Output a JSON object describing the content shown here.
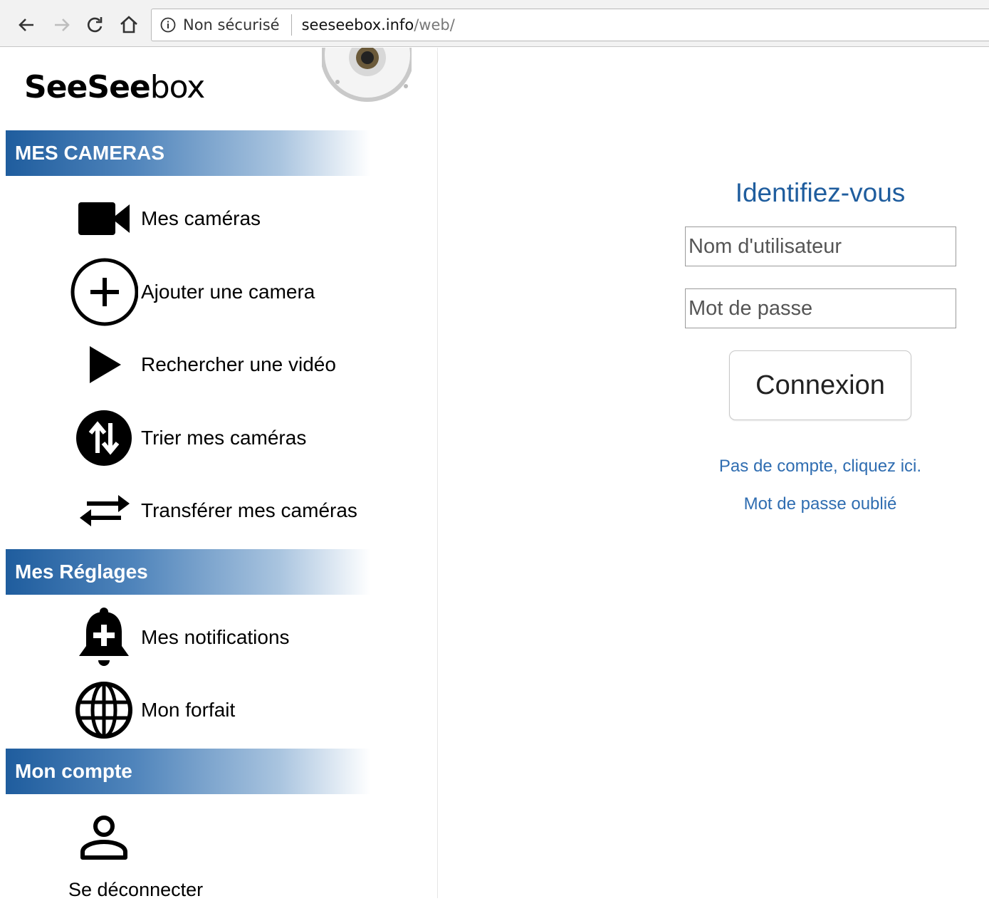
{
  "browser": {
    "security_label": "Non sécurisé",
    "url_host": "seeseebox.info",
    "url_path": "/web/"
  },
  "brand": {
    "logo_bold": "SeeSee",
    "logo_regular": "box"
  },
  "sidebar": {
    "sections": [
      {
        "title": "MES CAMERAS"
      },
      {
        "title": "Mes Réglages"
      },
      {
        "title": "Mon compte"
      }
    ],
    "cameras_items": [
      {
        "label": "Mes caméras",
        "icon": "video-camera-icon"
      },
      {
        "label": "Ajouter une camera",
        "icon": "add-circle-icon"
      },
      {
        "label": "Rechercher une vidéo",
        "icon": "play-icon"
      },
      {
        "label": "Trier mes caméras",
        "icon": "sort-icon"
      },
      {
        "label": "Transférer mes caméras",
        "icon": "transfer-icon"
      }
    ],
    "settings_items": [
      {
        "label": "Mes notifications",
        "icon": "bell-plus-icon"
      },
      {
        "label": "Mon forfait",
        "icon": "globe-icon"
      }
    ],
    "account_items": [
      {
        "label": "Se déconnecter",
        "icon": "user-icon"
      }
    ]
  },
  "login": {
    "title": "Identifiez-vous",
    "username_placeholder": "Nom d'utilisateur",
    "password_placeholder": "Mot de passe",
    "submit_label": "Connexion",
    "register_link": "Pas de compte, cliquez ici.",
    "forgot_link": "Mot de passe oublié"
  },
  "colors": {
    "accent": "#1f5d9e",
    "link": "#2f6db1"
  }
}
